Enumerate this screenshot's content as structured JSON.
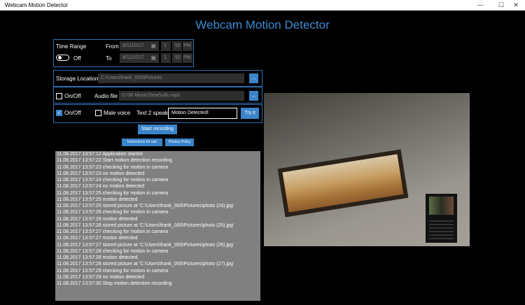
{
  "window": {
    "title": "Webcam Motion Detector"
  },
  "app": {
    "title": "Webcam Motion Detector"
  },
  "time_range": {
    "label": "Time Range",
    "toggle_state": "Off",
    "from_label": "From",
    "to_label": "To",
    "from": {
      "date": "8/11/2017",
      "hour": "1",
      "minute": "52",
      "period": "PM"
    },
    "to": {
      "date": "8/11/2017",
      "hour": "1",
      "minute": "52",
      "period": "PM"
    }
  },
  "storage": {
    "label": "Storage Location",
    "path": "C:\\Users\\frank_000\\Pictures",
    "browse_label": "..."
  },
  "audio": {
    "checkbox_label": "On/Off",
    "file_label": "Audio file",
    "path": "D:\\30 Music\\SeaGulls.mp3",
    "browse_label": "..."
  },
  "speech": {
    "checkbox_label": "On/Off",
    "male_voice_label": "Male voice",
    "text_label": "Text 2 speak",
    "text_value": "Motion Detected!",
    "try_label": "Try it"
  },
  "buttons": {
    "start": "Start recording",
    "instructions": "Instructions for use",
    "privacy": "Privacy Policy"
  },
  "log": [
    "11.08.2017 13:57:12 Application started",
    "11.08.2017 13:57:22 Start motion detection recording",
    "11.08.2017 13:57:23 checking for motion in camera",
    "11.08.2017 13:57:23 no motion detected",
    "11.08.2017 13:57:24 checking for motion in camera",
    "11.08.2017 13:57:24 no motion detected",
    "11.08.2017 13:57:25 checking for motion in camera",
    "11.08.2017 13:57:25 motion detected",
    "11.08.2017 13:57:25 stored picture at 'C:\\Users\\frank_000\\Pictures\\photo (24).jpg'",
    "11.08.2017 13:57:26 checking for motion in camera",
    "11.08.2017 13:57:26 motion detected",
    "11.08.2017 13:57:26 stored picture at 'C:\\Users\\frank_000\\Pictures\\photo (25).jpg'",
    "11.08.2017 13:57:27 checking for motion in camera",
    "11.08.2017 13:57:27 motion detected",
    "11.08.2017 13:57:27 stored picture at 'C:\\Users\\frank_000\\Pictures\\photo (26).jpg'",
    "11.08.2017 13:57:28 checking for motion in camera",
    "11.08.2017 13:57:28 motion detected",
    "11.08.2017 13:57:28 stored picture at 'C:\\Users\\frank_000\\Pictures\\photo (27).jpg'",
    "11.08.2017 13:57:29 checking for motion in camera",
    "11.08.2017 13:57:29 no motion detected",
    "11.08.2017 13:57:30 Stop motion detection recording"
  ],
  "colors": {
    "accent": "#3a84c9",
    "title": "#3b8ad3",
    "border": "#2f6fb0",
    "log_bg": "#808080"
  },
  "icons": {
    "minimize": "minimize-icon",
    "maximize": "maximize-icon",
    "close": "close-icon",
    "calendar": "calendar-icon",
    "check": "check-icon"
  }
}
